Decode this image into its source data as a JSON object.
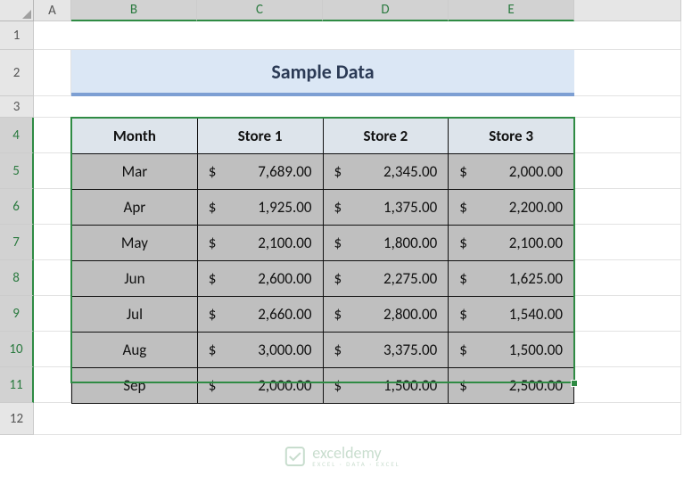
{
  "columns": [
    "A",
    "B",
    "C",
    "D",
    "E"
  ],
  "rows": [
    "1",
    "2",
    "3",
    "4",
    "5",
    "6",
    "7",
    "8",
    "9",
    "10",
    "11",
    "12"
  ],
  "title": "Sample Data",
  "headers": [
    "Month",
    "Store 1",
    "Store 2",
    "Store 3"
  ],
  "months": [
    "Mar",
    "Apr",
    "May",
    "Jun",
    "Jul",
    "Aug",
    "Sep"
  ],
  "currency_symbol": "$",
  "watermark": {
    "name": "exceldemy",
    "tagline": "EXCEL · DATA · EXCEL"
  },
  "chart_data": {
    "type": "table",
    "title": "Sample Data",
    "categories": [
      "Mar",
      "Apr",
      "May",
      "Jun",
      "Jul",
      "Aug",
      "Sep"
    ],
    "series": [
      {
        "name": "Store 1",
        "values": [
          7689.0,
          1925.0,
          2100.0,
          2600.0,
          2660.0,
          3000.0,
          2000.0
        ]
      },
      {
        "name": "Store 2",
        "values": [
          2345.0,
          1375.0,
          1800.0,
          2275.0,
          2800.0,
          3375.0,
          1500.0
        ]
      },
      {
        "name": "Store 3",
        "values": [
          2000.0,
          2200.0,
          2100.0,
          1625.0,
          1540.0,
          1500.0,
          2500.0
        ]
      }
    ],
    "xlabel": "Month",
    "ylabel": "",
    "currency": "$"
  }
}
